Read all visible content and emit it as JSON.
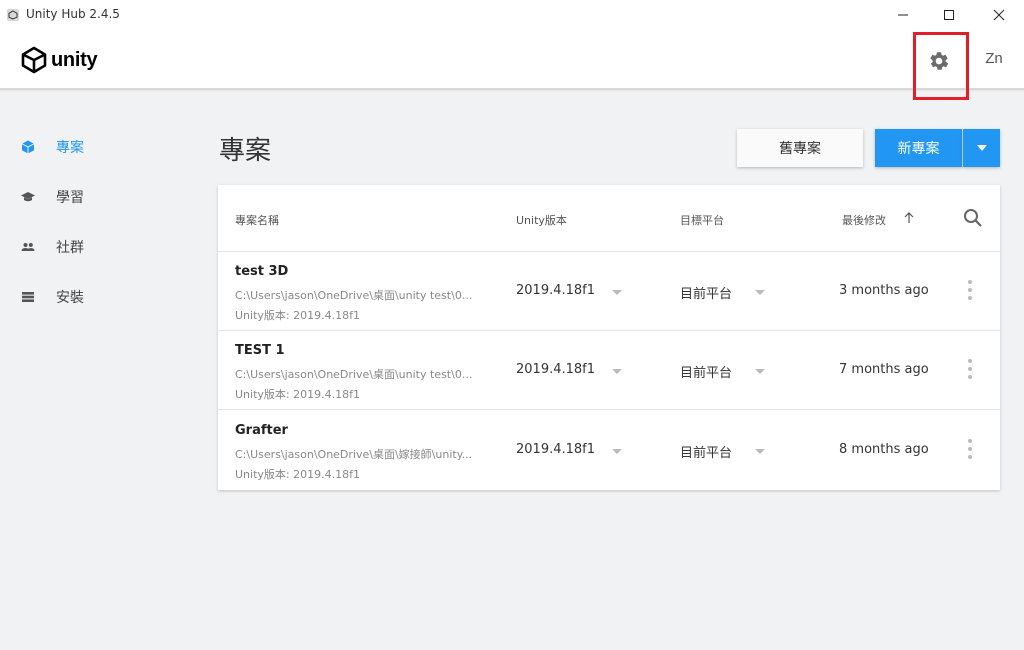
{
  "window": {
    "title": "Unity Hub 2.4.5"
  },
  "header": {
    "logo_text": "unity",
    "avatar_text": "Zn"
  },
  "sidebar": {
    "items": [
      {
        "label": "專案",
        "icon": "cube-icon",
        "active": true
      },
      {
        "label": "學習",
        "icon": "graduation-cap-icon",
        "active": false
      },
      {
        "label": "社群",
        "icon": "people-icon",
        "active": false
      },
      {
        "label": "安裝",
        "icon": "list-icon",
        "active": false
      }
    ]
  },
  "main": {
    "title": "專案",
    "open_button": "舊專案",
    "new_button": "新專案"
  },
  "table": {
    "columns": [
      "專案名稱",
      "Unity版本",
      "目標平台",
      "最後修改"
    ],
    "rows": [
      {
        "name": "test 3D",
        "path": "C:\\Users\\jason\\OneDrive\\桌面\\unity test\\0...",
        "unity_line": "Unity版本: 2019.4.18f1",
        "version": "2019.4.18f1",
        "platform": "目前平台",
        "modified": "3 months ago"
      },
      {
        "name": "TEST 1",
        "path": "C:\\Users\\jason\\OneDrive\\桌面\\unity test\\0...",
        "unity_line": "Unity版本: 2019.4.18f1",
        "version": "2019.4.18f1",
        "platform": "目前平台",
        "modified": "7 months ago"
      },
      {
        "name": "Grafter",
        "path": "C:\\Users\\jason\\OneDrive\\桌面\\嫁接師\\unity...",
        "unity_line": "Unity版本: 2019.4.18f1",
        "version": "2019.4.18f1",
        "platform": "目前平台",
        "modified": "8 months ago"
      }
    ]
  },
  "colors": {
    "accent": "#2196f3",
    "highlight": "#e31e26",
    "background": "#f1f2f3"
  }
}
